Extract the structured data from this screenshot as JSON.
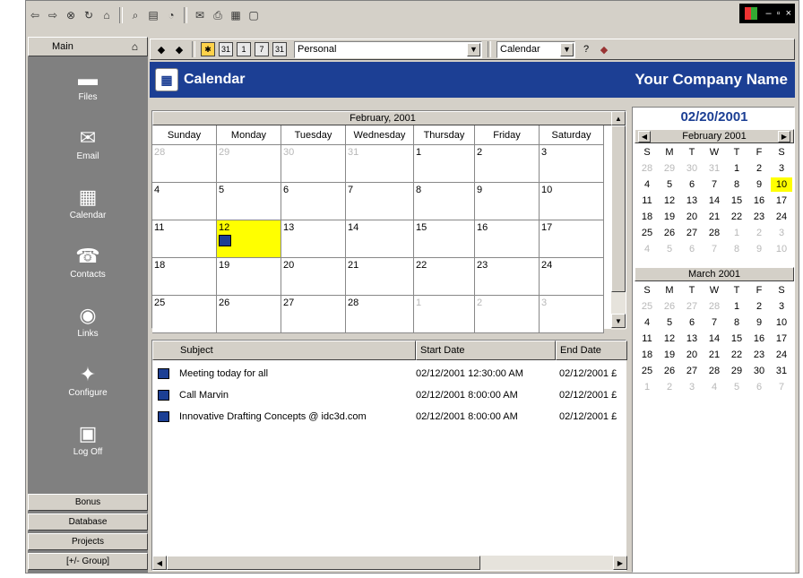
{
  "toolbar_icons": [
    "back-icon",
    "forward-icon",
    "stop-icon",
    "refresh-icon",
    "home-icon",
    "search-icon",
    "favorites-icon",
    "history-icon",
    "mail-icon",
    "print-icon",
    "edit-icon",
    "discuss-icon"
  ],
  "sidebar": {
    "title": "Main",
    "items": [
      {
        "label": "Files",
        "icon": "folder-icon",
        "glyph": "▬"
      },
      {
        "label": "Email",
        "icon": "email-icon",
        "glyph": "✉"
      },
      {
        "label": "Calendar",
        "icon": "calendar-icon",
        "glyph": "▦"
      },
      {
        "label": "Contacts",
        "icon": "contacts-icon",
        "glyph": "☎"
      },
      {
        "label": "Links",
        "icon": "links-icon",
        "glyph": "◉"
      },
      {
        "label": "Configure",
        "icon": "configure-icon",
        "glyph": "✦"
      },
      {
        "label": "Log Off",
        "icon": "logoff-icon",
        "glyph": "▣"
      }
    ],
    "groups": [
      "Bonus",
      "Database",
      "Projects",
      "[+/- Group]"
    ]
  },
  "toolbar2": {
    "buttons": [
      "31",
      "1",
      "7",
      "31"
    ],
    "category": "Personal",
    "view": "Calendar"
  },
  "header": {
    "title": "Calendar",
    "company": "Your Company Name"
  },
  "month_view": {
    "title": "February, 2001",
    "days": [
      "Sunday",
      "Monday",
      "Tuesday",
      "Wednesday",
      "Thursday",
      "Friday",
      "Saturday"
    ],
    "weeks": [
      [
        {
          "d": "28",
          "o": true
        },
        {
          "d": "29",
          "o": true
        },
        {
          "d": "30",
          "o": true
        },
        {
          "d": "31",
          "o": true
        },
        {
          "d": "1"
        },
        {
          "d": "2"
        },
        {
          "d": "3"
        }
      ],
      [
        {
          "d": "4"
        },
        {
          "d": "5"
        },
        {
          "d": "6"
        },
        {
          "d": "7"
        },
        {
          "d": "8"
        },
        {
          "d": "9"
        },
        {
          "d": "10"
        }
      ],
      [
        {
          "d": "11"
        },
        {
          "d": "12",
          "sel": true,
          "ev": true
        },
        {
          "d": "13"
        },
        {
          "d": "14"
        },
        {
          "d": "15"
        },
        {
          "d": "16"
        },
        {
          "d": "17"
        }
      ],
      [
        {
          "d": "18"
        },
        {
          "d": "19"
        },
        {
          "d": "20"
        },
        {
          "d": "21"
        },
        {
          "d": "22"
        },
        {
          "d": "23"
        },
        {
          "d": "24"
        }
      ],
      [
        {
          "d": "25"
        },
        {
          "d": "26"
        },
        {
          "d": "27"
        },
        {
          "d": "28"
        },
        {
          "d": "1",
          "o": true
        },
        {
          "d": "2",
          "o": true
        },
        {
          "d": "3",
          "o": true
        }
      ]
    ]
  },
  "events": {
    "columns": [
      "Subject",
      "Start Date",
      "End Date"
    ],
    "rows": [
      {
        "subject": "Meeting today for all",
        "start": "02/12/2001 12:30:00 AM",
        "end": "02/12/2001 £"
      },
      {
        "subject": "Call Marvin",
        "start": "02/12/2001 8:00:00 AM",
        "end": "02/12/2001 £"
      },
      {
        "subject": "Innovative Drafting Concepts @ idc3d.com",
        "start": "02/12/2001 8:00:00 AM",
        "end": "02/12/2001 £"
      }
    ]
  },
  "mini": {
    "date": "02/20/2001",
    "dow": [
      "S",
      "M",
      "T",
      "W",
      "T",
      "F",
      "S"
    ],
    "months": [
      {
        "title": "February 2001",
        "arrows": true,
        "weeks": [
          [
            {
              "d": "28",
              "o": true
            },
            {
              "d": "29",
              "o": true
            },
            {
              "d": "30",
              "o": true
            },
            {
              "d": "31",
              "o": true
            },
            {
              "d": "1"
            },
            {
              "d": "2"
            },
            {
              "d": "3"
            }
          ],
          [
            {
              "d": "4"
            },
            {
              "d": "5"
            },
            {
              "d": "6"
            },
            {
              "d": "7"
            },
            {
              "d": "8"
            },
            {
              "d": "9"
            },
            {
              "d": "10",
              "sel": true
            }
          ],
          [
            {
              "d": "11"
            },
            {
              "d": "12"
            },
            {
              "d": "13"
            },
            {
              "d": "14"
            },
            {
              "d": "15"
            },
            {
              "d": "16"
            },
            {
              "d": "17"
            }
          ],
          [
            {
              "d": "18"
            },
            {
              "d": "19"
            },
            {
              "d": "20"
            },
            {
              "d": "21"
            },
            {
              "d": "22"
            },
            {
              "d": "23"
            },
            {
              "d": "24"
            }
          ],
          [
            {
              "d": "25"
            },
            {
              "d": "26"
            },
            {
              "d": "27"
            },
            {
              "d": "28"
            },
            {
              "d": "1",
              "o": true
            },
            {
              "d": "2",
              "o": true
            },
            {
              "d": "3",
              "o": true
            }
          ],
          [
            {
              "d": "4",
              "o": true
            },
            {
              "d": "5",
              "o": true
            },
            {
              "d": "6",
              "o": true
            },
            {
              "d": "7",
              "o": true
            },
            {
              "d": "8",
              "o": true
            },
            {
              "d": "9",
              "o": true
            },
            {
              "d": "10",
              "o": true
            }
          ]
        ]
      },
      {
        "title": "March 2001",
        "arrows": false,
        "weeks": [
          [
            {
              "d": "25",
              "o": true
            },
            {
              "d": "26",
              "o": true
            },
            {
              "d": "27",
              "o": true
            },
            {
              "d": "28",
              "o": true
            },
            {
              "d": "1"
            },
            {
              "d": "2"
            },
            {
              "d": "3"
            }
          ],
          [
            {
              "d": "4"
            },
            {
              "d": "5"
            },
            {
              "d": "6"
            },
            {
              "d": "7"
            },
            {
              "d": "8"
            },
            {
              "d": "9"
            },
            {
              "d": "10"
            }
          ],
          [
            {
              "d": "11"
            },
            {
              "d": "12"
            },
            {
              "d": "13"
            },
            {
              "d": "14"
            },
            {
              "d": "15"
            },
            {
              "d": "16"
            },
            {
              "d": "17"
            }
          ],
          [
            {
              "d": "18"
            },
            {
              "d": "19"
            },
            {
              "d": "20"
            },
            {
              "d": "21"
            },
            {
              "d": "22"
            },
            {
              "d": "23"
            },
            {
              "d": "24"
            }
          ],
          [
            {
              "d": "25"
            },
            {
              "d": "26"
            },
            {
              "d": "27"
            },
            {
              "d": "28"
            },
            {
              "d": "29"
            },
            {
              "d": "30"
            },
            {
              "d": "31"
            }
          ],
          [
            {
              "d": "1",
              "o": true
            },
            {
              "d": "2",
              "o": true
            },
            {
              "d": "3",
              "o": true
            },
            {
              "d": "4",
              "o": true
            },
            {
              "d": "5",
              "o": true
            },
            {
              "d": "6",
              "o": true
            },
            {
              "d": "7",
              "o": true
            }
          ]
        ]
      }
    ]
  },
  "colors": {
    "accent": "#1c3f94",
    "highlight": "#ffff00",
    "sidebar": "#808080",
    "chrome": "#d4d0c8"
  }
}
